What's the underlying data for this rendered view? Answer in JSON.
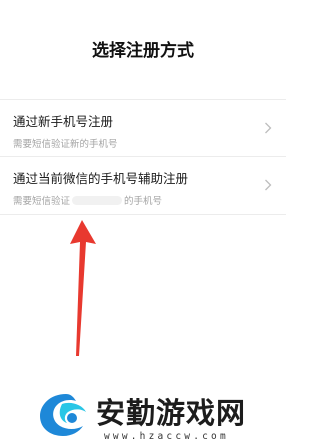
{
  "page": {
    "title": "选择注册方式"
  },
  "options": [
    {
      "title": "通过新手机号注册",
      "subtitle": "需要短信验证新的手机号"
    },
    {
      "title": "通过当前微信的手机号辅助注册",
      "subtitle_prefix": "需要短信验证",
      "subtitle_suffix": "的手机号"
    }
  ],
  "icons": {
    "chevron": "chevron-right-icon",
    "arrow": "red-arrow-pointer"
  },
  "colors": {
    "arrow": "#e8392f",
    "watermark_blue": "#1e88d8",
    "watermark_cyan": "#29c6e6"
  },
  "watermark": {
    "title": "安勤游戏网",
    "url": "www.hzaccw.com"
  }
}
